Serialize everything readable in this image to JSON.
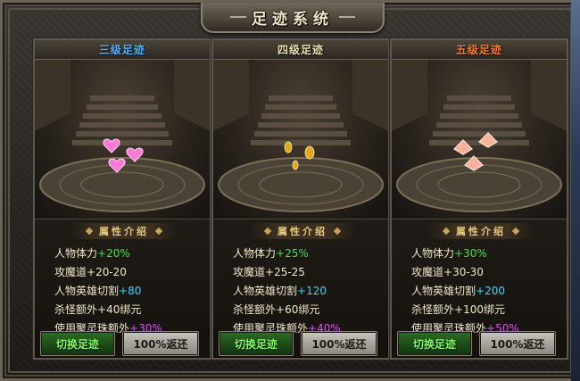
{
  "window": {
    "title": "足迹系统"
  },
  "panels": [
    {
      "name": "三级足迹",
      "attr_title": "属性介绍",
      "attrs": [
        {
          "label": "人物体力",
          "value": "+20%"
        },
        {
          "label": "攻魔道",
          "value": "+20-20"
        },
        {
          "label": "人物英雄切割",
          "value": "+80"
        },
        {
          "label": "杀怪额外",
          "value": "+40绑元"
        },
        {
          "label": "使用聚灵珠额外",
          "value": "+30%"
        }
      ],
      "switch_label": "切换足迹",
      "refund_label": "100%返还"
    },
    {
      "name": "四级足迹",
      "attr_title": "属性介绍",
      "attrs": [
        {
          "label": "人物体力",
          "value": "+25%"
        },
        {
          "label": "攻魔道",
          "value": "+25-25"
        },
        {
          "label": "人物英雄切割",
          "value": "+120"
        },
        {
          "label": "杀怪额外",
          "value": "+60绑元"
        },
        {
          "label": "使用聚灵珠额外",
          "value": "+40%"
        }
      ],
      "switch_label": "切换足迹",
      "refund_label": "100%返还"
    },
    {
      "name": "五级足迹",
      "attr_title": "属性介绍",
      "attrs": [
        {
          "label": "人物体力",
          "value": "+30%"
        },
        {
          "label": "攻魔道",
          "value": "+30-30"
        },
        {
          "label": "人物英雄切割",
          "value": "+200"
        },
        {
          "label": "杀怪额外",
          "value": "+100绑元"
        },
        {
          "label": "使用聚灵珠额外",
          "value": "+50%"
        }
      ],
      "switch_label": "切换足迹",
      "refund_label": "100%返还"
    }
  ],
  "icons": {
    "close": "close-icon",
    "footprint_tier3": "heart-footprint-icon",
    "footprint_tier4": "gold-footprint-icon",
    "footprint_tier5": "lotus-footprint-icon"
  },
  "colors": {
    "tier3_name": "#4fb4ff",
    "tier4_name": "#f0e2b0",
    "tier5_name": "#ff7a2a",
    "percent_value": "#3fe14a",
    "cut_value": "#3fd4ff",
    "orb_value": "#e04cff"
  }
}
